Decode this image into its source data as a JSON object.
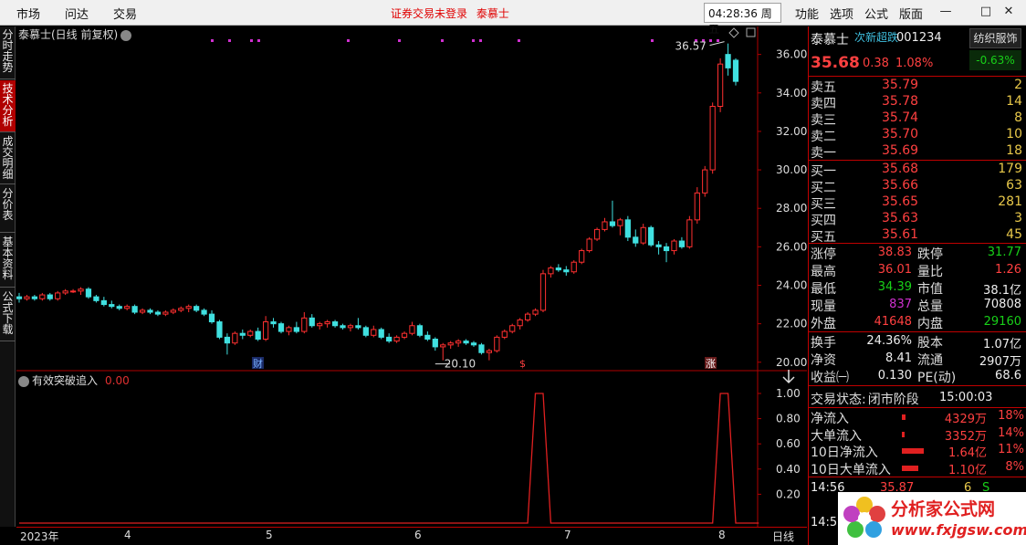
{
  "menubar": {
    "items": [
      "市场",
      "问达",
      "交易"
    ],
    "notice": "证券交易未登录",
    "stock_short": "泰慕士",
    "clock": "04:28:36",
    "weekday": "周五",
    "right_items": [
      "功能",
      "选项",
      "公式",
      "版面"
    ],
    "min_icon": "minimize-icon",
    "max_icon": "maximize-icon",
    "close_icon": "close-icon"
  },
  "left_tabs": [
    {
      "label": "分时走势",
      "active": false
    },
    {
      "label": "技术分析",
      "active": true
    },
    {
      "label": "成交明细",
      "active": false
    },
    {
      "label": "分价表",
      "active": false
    },
    {
      "label": "基本资料",
      "active": false
    },
    {
      "label": "公式下载",
      "active": false
    }
  ],
  "main_chart": {
    "title": "泰慕士(日线 前复权)",
    "high_label": "36.57",
    "low_label": "20.10",
    "markers": [
      "财",
      "$",
      "涨"
    ],
    "y_ticks": [
      "36.00",
      "34.00",
      "32.00",
      "30.00",
      "28.00",
      "26.00",
      "24.00",
      "22.00",
      "20.00"
    ],
    "x_labels": [
      "2023年",
      "4",
      "5",
      "6",
      "7",
      "8"
    ],
    "period_label": "日线"
  },
  "oscillator": {
    "title": "有效突破追入",
    "value": "0.00",
    "y_ticks": [
      "1.00",
      "0.80",
      "0.60",
      "0.40",
      "0.20"
    ]
  },
  "chart_data": {
    "type": "candlestick",
    "ylim": [
      20,
      36.6
    ],
    "candles": [
      {
        "o": 23.4,
        "h": 23.6,
        "l": 23.1,
        "c": 23.3
      },
      {
        "o": 23.3,
        "h": 23.5,
        "l": 23.2,
        "c": 23.4
      },
      {
        "o": 23.4,
        "h": 23.5,
        "l": 23.2,
        "c": 23.3
      },
      {
        "o": 23.3,
        "h": 23.6,
        "l": 23.2,
        "c": 23.5
      },
      {
        "o": 23.5,
        "h": 23.6,
        "l": 23.2,
        "c": 23.3
      },
      {
        "o": 23.3,
        "h": 23.7,
        "l": 23.2,
        "c": 23.6
      },
      {
        "o": 23.6,
        "h": 23.8,
        "l": 23.5,
        "c": 23.7
      },
      {
        "o": 23.7,
        "h": 23.8,
        "l": 23.6,
        "c": 23.7
      },
      {
        "o": 23.7,
        "h": 23.9,
        "l": 23.5,
        "c": 23.8
      },
      {
        "o": 23.8,
        "h": 23.9,
        "l": 23.3,
        "c": 23.4
      },
      {
        "o": 23.4,
        "h": 23.5,
        "l": 23.1,
        "c": 23.2
      },
      {
        "o": 23.2,
        "h": 23.4,
        "l": 22.9,
        "c": 23.0
      },
      {
        "o": 23.0,
        "h": 23.2,
        "l": 22.8,
        "c": 22.9
      },
      {
        "o": 22.9,
        "h": 23.0,
        "l": 22.7,
        "c": 22.8
      },
      {
        "o": 22.8,
        "h": 23.0,
        "l": 22.7,
        "c": 22.9
      },
      {
        "o": 22.9,
        "h": 23.0,
        "l": 22.5,
        "c": 22.6
      },
      {
        "o": 22.6,
        "h": 22.8,
        "l": 22.5,
        "c": 22.7
      },
      {
        "o": 22.7,
        "h": 22.8,
        "l": 22.5,
        "c": 22.6
      },
      {
        "o": 22.6,
        "h": 22.7,
        "l": 22.4,
        "c": 22.5
      },
      {
        "o": 22.5,
        "h": 22.7,
        "l": 22.4,
        "c": 22.6
      },
      {
        "o": 22.6,
        "h": 22.8,
        "l": 22.5,
        "c": 22.7
      },
      {
        "o": 22.7,
        "h": 22.9,
        "l": 22.6,
        "c": 22.8
      },
      {
        "o": 22.8,
        "h": 23.0,
        "l": 22.6,
        "c": 22.9
      },
      {
        "o": 22.9,
        "h": 23.0,
        "l": 22.6,
        "c": 22.7
      },
      {
        "o": 22.7,
        "h": 22.8,
        "l": 22.4,
        "c": 22.5
      },
      {
        "o": 22.5,
        "h": 22.7,
        "l": 22.0,
        "c": 22.1
      },
      {
        "o": 22.1,
        "h": 22.2,
        "l": 21.2,
        "c": 21.3
      },
      {
        "o": 21.3,
        "h": 21.5,
        "l": 20.4,
        "c": 21.0
      },
      {
        "o": 21.0,
        "h": 21.6,
        "l": 20.9,
        "c": 21.5
      },
      {
        "o": 21.5,
        "h": 21.7,
        "l": 21.2,
        "c": 21.4
      },
      {
        "o": 21.4,
        "h": 21.7,
        "l": 21.3,
        "c": 21.6
      },
      {
        "o": 21.6,
        "h": 21.8,
        "l": 21.1,
        "c": 21.2
      },
      {
        "o": 21.2,
        "h": 22.4,
        "l": 21.1,
        "c": 22.1
      },
      {
        "o": 22.1,
        "h": 22.3,
        "l": 21.8,
        "c": 22.0
      },
      {
        "o": 22.0,
        "h": 22.1,
        "l": 21.5,
        "c": 21.6
      },
      {
        "o": 21.6,
        "h": 21.9,
        "l": 21.4,
        "c": 21.8
      },
      {
        "o": 21.8,
        "h": 22.1,
        "l": 21.5,
        "c": 21.6
      },
      {
        "o": 21.6,
        "h": 22.6,
        "l": 21.5,
        "c": 22.3
      },
      {
        "o": 22.3,
        "h": 22.5,
        "l": 21.8,
        "c": 21.9
      },
      {
        "o": 21.9,
        "h": 22.1,
        "l": 21.7,
        "c": 22.0
      },
      {
        "o": 22.0,
        "h": 22.2,
        "l": 21.8,
        "c": 22.1
      },
      {
        "o": 22.1,
        "h": 22.2,
        "l": 21.8,
        "c": 21.9
      },
      {
        "o": 21.9,
        "h": 22.0,
        "l": 21.7,
        "c": 21.8
      },
      {
        "o": 21.8,
        "h": 22.0,
        "l": 21.6,
        "c": 21.9
      },
      {
        "o": 21.9,
        "h": 22.3,
        "l": 21.7,
        "c": 21.8
      },
      {
        "o": 21.8,
        "h": 21.9,
        "l": 21.3,
        "c": 21.4
      },
      {
        "o": 21.4,
        "h": 21.9,
        "l": 21.3,
        "c": 21.7
      },
      {
        "o": 21.7,
        "h": 21.8,
        "l": 21.2,
        "c": 21.3
      },
      {
        "o": 21.3,
        "h": 21.5,
        "l": 21.0,
        "c": 21.1
      },
      {
        "o": 21.1,
        "h": 21.4,
        "l": 21.0,
        "c": 21.3
      },
      {
        "o": 21.3,
        "h": 21.6,
        "l": 21.2,
        "c": 21.5
      },
      {
        "o": 21.5,
        "h": 22.1,
        "l": 21.4,
        "c": 21.9
      },
      {
        "o": 21.9,
        "h": 22.0,
        "l": 21.3,
        "c": 21.4
      },
      {
        "o": 21.4,
        "h": 21.6,
        "l": 21.1,
        "c": 21.2
      },
      {
        "o": 21.2,
        "h": 21.3,
        "l": 20.6,
        "c": 20.8
      },
      {
        "o": 20.8,
        "h": 21.0,
        "l": 20.1,
        "c": 20.9
      },
      {
        "o": 20.9,
        "h": 21.1,
        "l": 20.7,
        "c": 21.0
      },
      {
        "o": 21.0,
        "h": 21.2,
        "l": 20.8,
        "c": 21.1
      },
      {
        "o": 21.1,
        "h": 21.2,
        "l": 20.9,
        "c": 21.0
      },
      {
        "o": 21.0,
        "h": 21.1,
        "l": 20.8,
        "c": 20.9
      },
      {
        "o": 20.9,
        "h": 21.0,
        "l": 20.4,
        "c": 20.5
      },
      {
        "o": 20.5,
        "h": 20.7,
        "l": 20.1,
        "c": 20.6
      },
      {
        "o": 20.6,
        "h": 21.4,
        "l": 20.5,
        "c": 21.3
      },
      {
        "o": 21.3,
        "h": 21.7,
        "l": 21.2,
        "c": 21.6
      },
      {
        "o": 21.6,
        "h": 22.0,
        "l": 21.5,
        "c": 21.9
      },
      {
        "o": 21.9,
        "h": 22.3,
        "l": 21.7,
        "c": 22.2
      },
      {
        "o": 22.2,
        "h": 22.6,
        "l": 22.1,
        "c": 22.5
      },
      {
        "o": 22.5,
        "h": 22.8,
        "l": 22.4,
        "c": 22.7
      },
      {
        "o": 22.7,
        "h": 24.8,
        "l": 22.6,
        "c": 24.6
      },
      {
        "o": 24.6,
        "h": 25.0,
        "l": 24.4,
        "c": 24.9
      },
      {
        "o": 24.9,
        "h": 25.1,
        "l": 24.7,
        "c": 24.8
      },
      {
        "o": 24.8,
        "h": 25.0,
        "l": 24.5,
        "c": 24.7
      },
      {
        "o": 24.7,
        "h": 25.3,
        "l": 24.6,
        "c": 25.2
      },
      {
        "o": 25.2,
        "h": 25.9,
        "l": 25.1,
        "c": 25.8
      },
      {
        "o": 25.8,
        "h": 26.5,
        "l": 25.7,
        "c": 26.4
      },
      {
        "o": 26.4,
        "h": 27.0,
        "l": 26.3,
        "c": 26.9
      },
      {
        "o": 26.9,
        "h": 27.5,
        "l": 26.8,
        "c": 27.3
      },
      {
        "o": 27.3,
        "h": 28.4,
        "l": 27.0,
        "c": 27.1
      },
      {
        "o": 27.1,
        "h": 27.5,
        "l": 26.6,
        "c": 27.4
      },
      {
        "o": 27.4,
        "h": 27.6,
        "l": 26.3,
        "c": 26.5
      },
      {
        "o": 26.5,
        "h": 26.9,
        "l": 26.0,
        "c": 26.2
      },
      {
        "o": 26.2,
        "h": 27.2,
        "l": 26.1,
        "c": 27.0
      },
      {
        "o": 27.0,
        "h": 27.1,
        "l": 26.0,
        "c": 26.1
      },
      {
        "o": 26.1,
        "h": 26.3,
        "l": 25.6,
        "c": 26.0
      },
      {
        "o": 26.0,
        "h": 26.2,
        "l": 25.2,
        "c": 25.8
      },
      {
        "o": 25.8,
        "h": 26.4,
        "l": 25.6,
        "c": 26.3
      },
      {
        "o": 26.3,
        "h": 26.5,
        "l": 25.9,
        "c": 26.0
      },
      {
        "o": 26.0,
        "h": 27.6,
        "l": 25.9,
        "c": 27.4
      },
      {
        "o": 27.4,
        "h": 29.1,
        "l": 27.2,
        "c": 28.8
      },
      {
        "o": 28.8,
        "h": 30.2,
        "l": 28.6,
        "c": 30.0
      },
      {
        "o": 30.0,
        "h": 33.5,
        "l": 29.8,
        "c": 33.3
      },
      {
        "o": 33.3,
        "h": 35.8,
        "l": 33.0,
        "c": 35.5
      },
      {
        "o": 36.0,
        "h": 36.57,
        "l": 34.9,
        "c": 35.3
      },
      {
        "o": 35.7,
        "h": 35.8,
        "l": 34.39,
        "c": 34.6
      }
    ],
    "oscillator": [
      0,
      0,
      0,
      0,
      0,
      0,
      0,
      0,
      0,
      0,
      0,
      0,
      0,
      0,
      0,
      0,
      0,
      0,
      0,
      0,
      0,
      0,
      0,
      0,
      0,
      0,
      0,
      0,
      0,
      0,
      0,
      0,
      0,
      0,
      0,
      0,
      0,
      0,
      0,
      0,
      0,
      0,
      0,
      0,
      0,
      0,
      0,
      0,
      0,
      0,
      0,
      0,
      0,
      0,
      0,
      0,
      0,
      0,
      0,
      0,
      0,
      0,
      0,
      0,
      0,
      0,
      0,
      1,
      1,
      0,
      0,
      0,
      0,
      0,
      0,
      0,
      0,
      0,
      0,
      0,
      0,
      0,
      0,
      0,
      0,
      0,
      0,
      0,
      0,
      0,
      0,
      1,
      1,
      0,
      0,
      0,
      0
    ]
  },
  "quote": {
    "name": "泰慕士",
    "tag": "次新超跌",
    "code": "001234",
    "industry": "纺织服饰",
    "industry_change": "-0.63%",
    "price": "35.68",
    "change": "0.38",
    "change_pct": "1.08%",
    "asks": [
      {
        "label": "卖五",
        "price": "35.79",
        "vol": "2"
      },
      {
        "label": "卖四",
        "price": "35.78",
        "vol": "14"
      },
      {
        "label": "卖三",
        "price": "35.74",
        "vol": "8"
      },
      {
        "label": "卖二",
        "price": "35.70",
        "vol": "10"
      },
      {
        "label": "卖一",
        "price": "35.69",
        "vol": "18"
      }
    ],
    "bids": [
      {
        "label": "买一",
        "price": "35.68",
        "vol": "179"
      },
      {
        "label": "买二",
        "price": "35.66",
        "vol": "63"
      },
      {
        "label": "买三",
        "price": "35.65",
        "vol": "281"
      },
      {
        "label": "买四",
        "price": "35.63",
        "vol": "3"
      },
      {
        "label": "买五",
        "price": "35.61",
        "vol": "45"
      }
    ],
    "stats": [
      {
        "l1": "涨停",
        "v1": "38.83",
        "c1": "red",
        "l2": "跌停",
        "v2": "31.77",
        "c2": "green"
      },
      {
        "l1": "最高",
        "v1": "36.01",
        "c1": "red",
        "l2": "量比",
        "v2": "1.26",
        "c2": "red"
      },
      {
        "l1": "最低",
        "v1": "34.39",
        "c1": "green",
        "l2": "市值",
        "v2": "38.1亿",
        "c2": "white"
      },
      {
        "l1": "现量",
        "v1": "837",
        "c1": "magenta",
        "l2": "总量",
        "v2": "70808",
        "c2": "white"
      },
      {
        "l1": "外盘",
        "v1": "41648",
        "c1": "red",
        "l2": "内盘",
        "v2": "29160",
        "c2": "green"
      }
    ],
    "stats2": [
      {
        "l1": "换手",
        "v1": "24.36%",
        "l2": "股本",
        "v2": "1.07亿"
      },
      {
        "l1": "净资",
        "v1": "8.41",
        "l2": "流通",
        "v2": "2907万"
      },
      {
        "l1": "收益㈠",
        "v1": "0.130",
        "l2": "PE(动)",
        "v2": "68.6"
      }
    ],
    "trade_status": "交易状态:",
    "trade_phase": "闭市阶段",
    "trade_time": "15:00:03",
    "flows": [
      {
        "label": "净流入",
        "amount": "4329万",
        "pct": "18%",
        "bar": 0.1
      },
      {
        "label": "大单流入",
        "amount": "3352万",
        "pct": "14%",
        "bar": 0.08
      },
      {
        "label": "10日净流入",
        "amount": "1.64亿",
        "pct": "11%",
        "bar": 0.6
      },
      {
        "label": "10日大单流入",
        "amount": "1.10亿",
        "pct": "8%",
        "bar": 0.45
      }
    ],
    "tick": {
      "time": "14:56",
      "price": "35.87",
      "vol": "6",
      "flag": "S"
    },
    "tick2_time": "14:5"
  },
  "watermark": {
    "title": "分析家公式网",
    "url": "www.fxjgsw.com"
  },
  "colors": {
    "up": "#ff3030",
    "down": "#40e0e0",
    "grid": "#8b0000"
  }
}
